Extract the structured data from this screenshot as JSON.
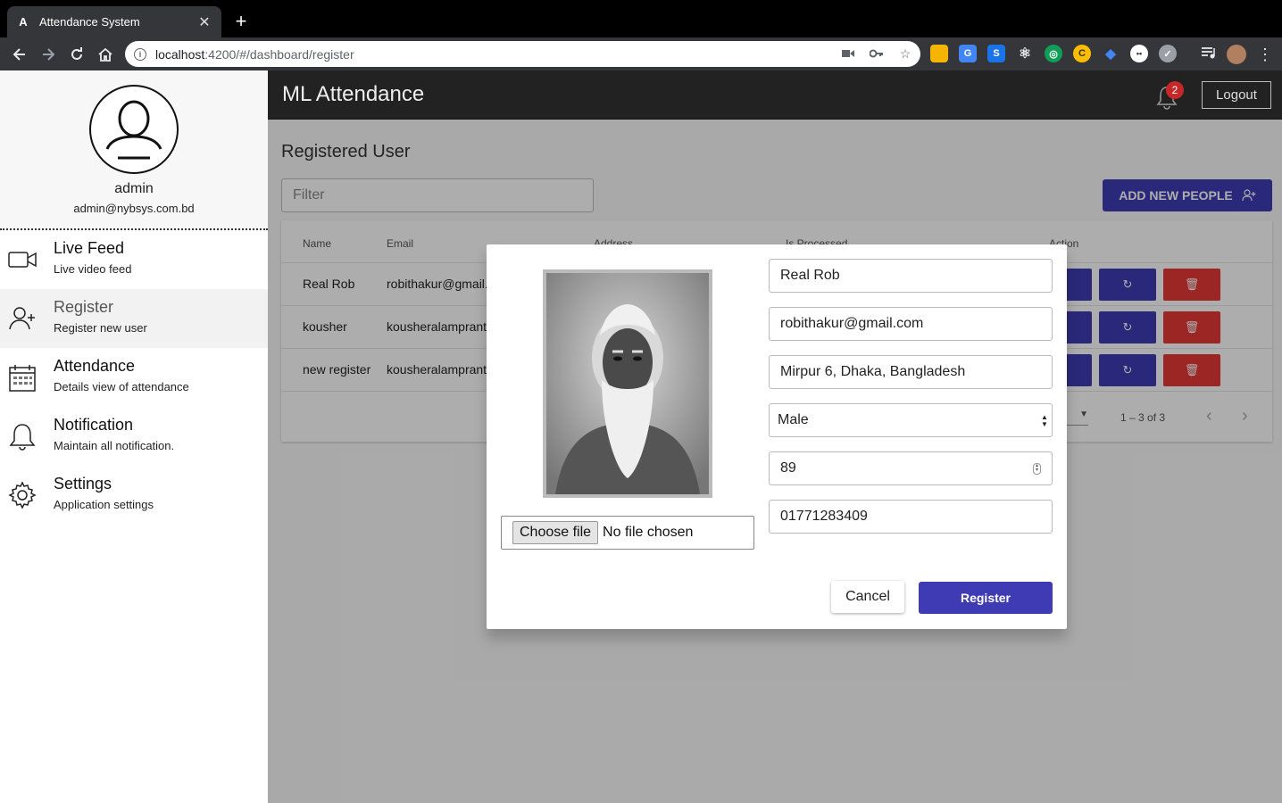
{
  "browser": {
    "tab_title": "Attendance System",
    "url_host": "localhost",
    "url_path": ":4200/#/dashboard/register"
  },
  "sidebar": {
    "user_name": "admin",
    "user_email": "admin@nybsys.com.bd",
    "items": [
      {
        "title": "Live Feed",
        "subtitle": "Live video feed",
        "icon": "video-camera-icon"
      },
      {
        "title": "Register",
        "subtitle": "Register new user",
        "icon": "add-user-icon"
      },
      {
        "title": "Attendance",
        "subtitle": "Details view of attendance",
        "icon": "calendar-icon"
      },
      {
        "title": "Notification",
        "subtitle": "Maintain all notification.",
        "icon": "bell-icon"
      },
      {
        "title": "Settings",
        "subtitle": "Application settings",
        "icon": "gear-icon"
      }
    ],
    "active_index": 1
  },
  "header": {
    "app_title": "ML Attendance",
    "notification_count": "2",
    "logout_label": "Logout"
  },
  "page": {
    "heading": "Registered User",
    "filter_placeholder": "Filter",
    "add_button_label": "ADD NEW PEOPLE",
    "columns": [
      "Name",
      "Email",
      "Address",
      "Is Processed",
      "Action"
    ],
    "rows": [
      {
        "name": "Real Rob",
        "email": "robithakur@gmail."
      },
      {
        "name": "kousher",
        "email": "kousheralamprant"
      },
      {
        "name": "new register",
        "email": "kousheralamprant"
      }
    ],
    "range_label": "1 – 3 of 3"
  },
  "modal": {
    "file_button_label": "Choose file",
    "file_status": "No file chosen",
    "name_value": "Real Rob",
    "email_value": "robithakur@gmail.com",
    "address_value": "Mirpur 6, Dhaka, Bangladesh",
    "gender_value": "Male",
    "age_value": "89",
    "phone_value": "01771283409",
    "cancel_label": "Cancel",
    "register_label": "Register"
  },
  "colors": {
    "primary": "#3f3bb5",
    "danger": "#e53935",
    "topbar": "#222222",
    "badge": "#c62828"
  }
}
